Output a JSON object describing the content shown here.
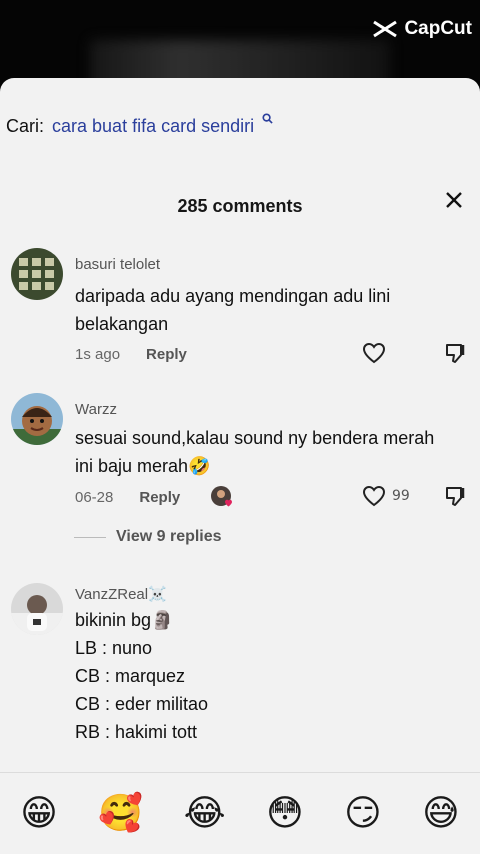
{
  "watermark": {
    "brand": "CapCut"
  },
  "search": {
    "label": "Cari:",
    "query": "cara buat fifa card sendiri"
  },
  "header": {
    "count_text": "285 comments"
  },
  "comments": [
    {
      "username": "basuri telolet",
      "text": "daripada adu ayang mendingan adu lini belakangan",
      "time": "1s ago",
      "reply": "Reply",
      "likes": ""
    },
    {
      "username": "Warzz",
      "text": "sesuai sound,kalau sound ny bendera merah ini baju merah🤣",
      "time": "06-28",
      "reply": "Reply",
      "likes": "99"
    },
    {
      "username": "VanzZReal☠️",
      "text": "bikinin bg🗿\nLB : nuno\nCB : marquez\nCB : eder militao\nRB : hakimi tott",
      "time": "",
      "reply": "",
      "likes": ""
    }
  ],
  "view_replies": {
    "label": "View 9 replies"
  },
  "emoji_bar": [
    "😁",
    "🥰",
    "😂",
    "😳",
    "😏",
    "😅"
  ]
}
